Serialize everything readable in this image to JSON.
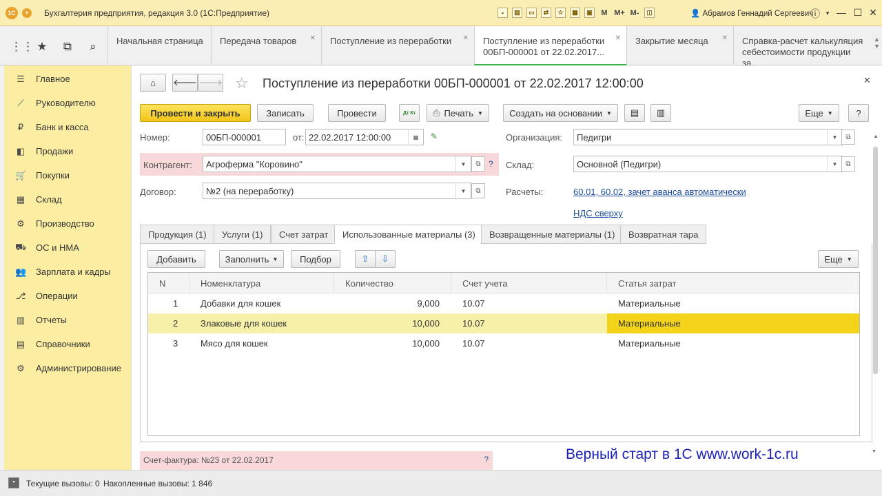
{
  "window": {
    "title": "Бухгалтерия предприятия, редакция 3.0 (1С:Предприятие)",
    "user": "Абрамов Геннадий Сергеевич"
  },
  "title_icons": {
    "memory": [
      "M",
      "M+",
      "M-"
    ]
  },
  "tabs": [
    {
      "label": "Начальная страница",
      "closable": false
    },
    {
      "label": "Передача товаров",
      "closable": true
    },
    {
      "label": "Поступление из переработки",
      "closable": true
    },
    {
      "label": "Поступление из переработки 00БП-000001 от 22.02.2017...",
      "closable": true,
      "active": true
    },
    {
      "label": "Закрытие месяца",
      "closable": true
    },
    {
      "label": "Справка-расчет калькуляция себестоимости продукции за...",
      "closable": false
    }
  ],
  "sidebar": {
    "items": [
      {
        "label": "Главное",
        "icon": "menu-icon"
      },
      {
        "label": "Руководителю",
        "icon": "chart-icon"
      },
      {
        "label": "Банк и касса",
        "icon": "ruble-icon"
      },
      {
        "label": "Продажи",
        "icon": "sales-icon"
      },
      {
        "label": "Покупки",
        "icon": "cart-icon"
      },
      {
        "label": "Склад",
        "icon": "warehouse-icon"
      },
      {
        "label": "Производство",
        "icon": "production-icon"
      },
      {
        "label": "ОС и НМА",
        "icon": "assets-icon"
      },
      {
        "label": "Зарплата и кадры",
        "icon": "people-icon"
      },
      {
        "label": "Операции",
        "icon": "operations-icon"
      },
      {
        "label": "Отчеты",
        "icon": "reports-icon"
      },
      {
        "label": "Справочники",
        "icon": "book-icon"
      },
      {
        "label": "Администрирование",
        "icon": "gear-icon"
      }
    ]
  },
  "doc": {
    "title": "Поступление из переработки 00БП-000001 от 22.02.2017 12:00:00",
    "toolbar": {
      "post_close": "Провести и закрыть",
      "save": "Записать",
      "post": "Провести",
      "dt_kt": "Дт Кт",
      "print": "Печать",
      "create_based": "Создать на основании",
      "more": "Еще",
      "help": "?"
    },
    "number_label": "Номер:",
    "number": "00БП-000001",
    "date_label": "от:",
    "date": "22.02.2017 12:00:00",
    "org_label": "Организация:",
    "org": "Педигри",
    "contractor_label": "Контрагент:",
    "contractor": "Агроферма \"Коровино\"",
    "warehouse_label": "Склад:",
    "warehouse": "Основной (Педигри)",
    "contract_label": "Договор:",
    "contract": "№2 (на переработку)",
    "settlements_label": "Расчеты:",
    "settlements_link": "60.01, 60.02, зачет аванса автоматически",
    "vat_link": "НДС сверху",
    "invoice_text": "Счет-фактура: №23 от 22.02.2017",
    "tabs": [
      "Продукция (1)",
      "Услуги (1)",
      "Счет затрат",
      "Использованные материалы (3)",
      "Возвращенные материалы (1)",
      "Возвратная тара"
    ],
    "table_toolbar": {
      "add": "Добавить",
      "fill": "Заполнить",
      "pick": "Подбор",
      "more": "Еще"
    },
    "columns": [
      "N",
      "Номенклатура",
      "Количество",
      "Счет учета",
      "Статья затрат"
    ],
    "rows": [
      {
        "n": "1",
        "item": "Добавки для кошек",
        "qty": "9,000",
        "account": "10.07",
        "cost": "Материальные"
      },
      {
        "n": "2",
        "item": "Злаковые для кошек",
        "qty": "10,000",
        "account": "10.07",
        "cost": "Материальные",
        "selected": true
      },
      {
        "n": "3",
        "item": "Мясо для кошек",
        "qty": "10,000",
        "account": "10.07",
        "cost": "Материальные"
      }
    ]
  },
  "watermark": "Верный старт в 1С www.work-1c.ru",
  "status": {
    "current": "Текущие вызовы: 0",
    "accumulated": "Накопленные вызовы: 1 846"
  },
  "colors": {
    "accent_yellow": "#f4c51a",
    "sidebar": "#fbeda2",
    "selection": "#f7f0a8",
    "link": "#1c4d9e",
    "active_tab_line": "#3bb246"
  }
}
